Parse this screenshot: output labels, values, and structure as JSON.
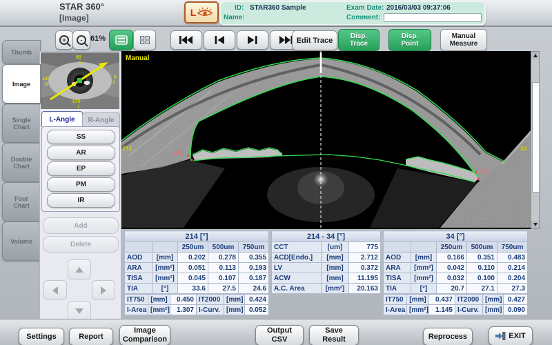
{
  "window": {
    "app_title": "STAR 360°",
    "view_label": "[Image]"
  },
  "patient": {
    "eye_letter": "L",
    "id_label": "ID:",
    "id_value": "STAR360 Sample",
    "exam_label": "Exam Date:",
    "exam_value": "2016/03/03 09:37:06",
    "name_label": "Name:",
    "name_value": "",
    "comment_label": "Comment:",
    "comment_value": ""
  },
  "toolbar": {
    "zoom_percent": "61%",
    "edit_trace": "Edit Trace",
    "disp_trace": "Disp.\nTrace",
    "disp_point": "Disp.\nPoint",
    "manual_measure": "Manual\nMeasure"
  },
  "icons": {
    "zoom_in": "magnifier-plus",
    "zoom_out": "magnifier-minus",
    "single_view": "rows-layout",
    "multi_view": "grid-layout",
    "first_frame": "skip-to-start",
    "prev_frame": "step-back",
    "next_frame": "step-forward",
    "last_frame": "skip-to-end",
    "exit": "door-exit-arrow",
    "eye_badge": "left-eye"
  },
  "sidebar": {
    "tabs": [
      "Thumb",
      "Image",
      "Single\nChart",
      "Double\nChart",
      "Four\nChart",
      "Volume"
    ]
  },
  "angle_panel": {
    "tabs": [
      "L-Angle",
      "R-Angle"
    ],
    "site_buttons": [
      "SS",
      "AR",
      "EP",
      "PM",
      "IR"
    ],
    "add_label": "Add",
    "delete_label": "Delete"
  },
  "thumbnail": {
    "top": [
      "90",
      "S"
    ],
    "left": [
      "180",
      "N"
    ],
    "right": [
      "0",
      "T"
    ],
    "bottom": [
      "270",
      "I"
    ]
  },
  "oct": {
    "mode_label": "Manual",
    "left_angle_label": "214",
    "right_angle_label": "34",
    "ss_label": "SS"
  },
  "tables": {
    "left": {
      "title": "214 [°]",
      "cols": [
        "250um",
        "500um",
        "750um"
      ],
      "rows": [
        {
          "name": "AOD",
          "unit": "[mm]",
          "values": [
            "0.202",
            "0.278",
            "0.355"
          ]
        },
        {
          "name": "ARA",
          "unit": "[mm²]",
          "values": [
            "0.051",
            "0.113",
            "0.193"
          ]
        },
        {
          "name": "TISA",
          "unit": "[mm²]",
          "values": [
            "0.045",
            "0.107",
            "0.187"
          ]
        },
        {
          "name": "TIA",
          "unit": "[°]",
          "values": [
            "33.6",
            "27.5",
            "24.6"
          ]
        }
      ],
      "extra": [
        {
          "l1": "IT750",
          "u1": "[mm]",
          "v1": "0.450",
          "l2": "IT2000",
          "u2": "[mm]",
          "v2": "0.424"
        },
        {
          "l1": "I-Area",
          "u1": "[mm²]",
          "v1": "1.307",
          "l2": "I-Curv.",
          "u2": "[mm]",
          "v2": "0.052"
        }
      ]
    },
    "center": {
      "title": "214 - 34 [°]",
      "rows": [
        {
          "name": "CCT",
          "unit": "[um]",
          "value": "775"
        },
        {
          "name": "ACD[Endo.]",
          "unit": "[mm]",
          "value": "2.712"
        },
        {
          "name": "LV",
          "unit": "[mm]",
          "value": "0.372"
        },
        {
          "name": "ACW",
          "unit": "[mm]",
          "value": "11.195"
        },
        {
          "name": "A.C. Area",
          "unit": "[mm²]",
          "value": "20.163"
        }
      ]
    },
    "right": {
      "title": "34 [°]",
      "cols": [
        "250um",
        "500um",
        "750um"
      ],
      "rows": [
        {
          "name": "AOD",
          "unit": "[mm]",
          "values": [
            "0.166",
            "0.351",
            "0.483"
          ]
        },
        {
          "name": "ARA",
          "unit": "[mm²]",
          "values": [
            "0.042",
            "0.110",
            "0.214"
          ]
        },
        {
          "name": "TISA",
          "unit": "[mm²]",
          "values": [
            "0.032",
            "0.100",
            "0.204"
          ]
        },
        {
          "name": "TIA",
          "unit": "[°]",
          "values": [
            "20.7",
            "27.1",
            "27.3"
          ]
        }
      ],
      "extra": [
        {
          "l1": "IT750",
          "u1": "[mm]",
          "v1": "0.437",
          "l2": "IT2000",
          "u2": "[mm]",
          "v2": "0.427"
        },
        {
          "l1": "I-Area",
          "u1": "[mm²]",
          "v1": "1.145",
          "l2": "I-Curv.",
          "u2": "[mm]",
          "v2": "0.090"
        }
      ]
    }
  },
  "footer": {
    "buttons": [
      "Settings",
      "Report",
      "Image\nComparison",
      "Output\nCSV",
      "Save\nResult",
      "Reprocess",
      "EXIT"
    ]
  },
  "colors": {
    "accent_green": "#2faa60",
    "trace_green": "#2ede4e",
    "marker_red": "#e05555",
    "label_yellow": "#e8e800",
    "table_text": "#1b3d7a",
    "info_teal": "#189078"
  }
}
